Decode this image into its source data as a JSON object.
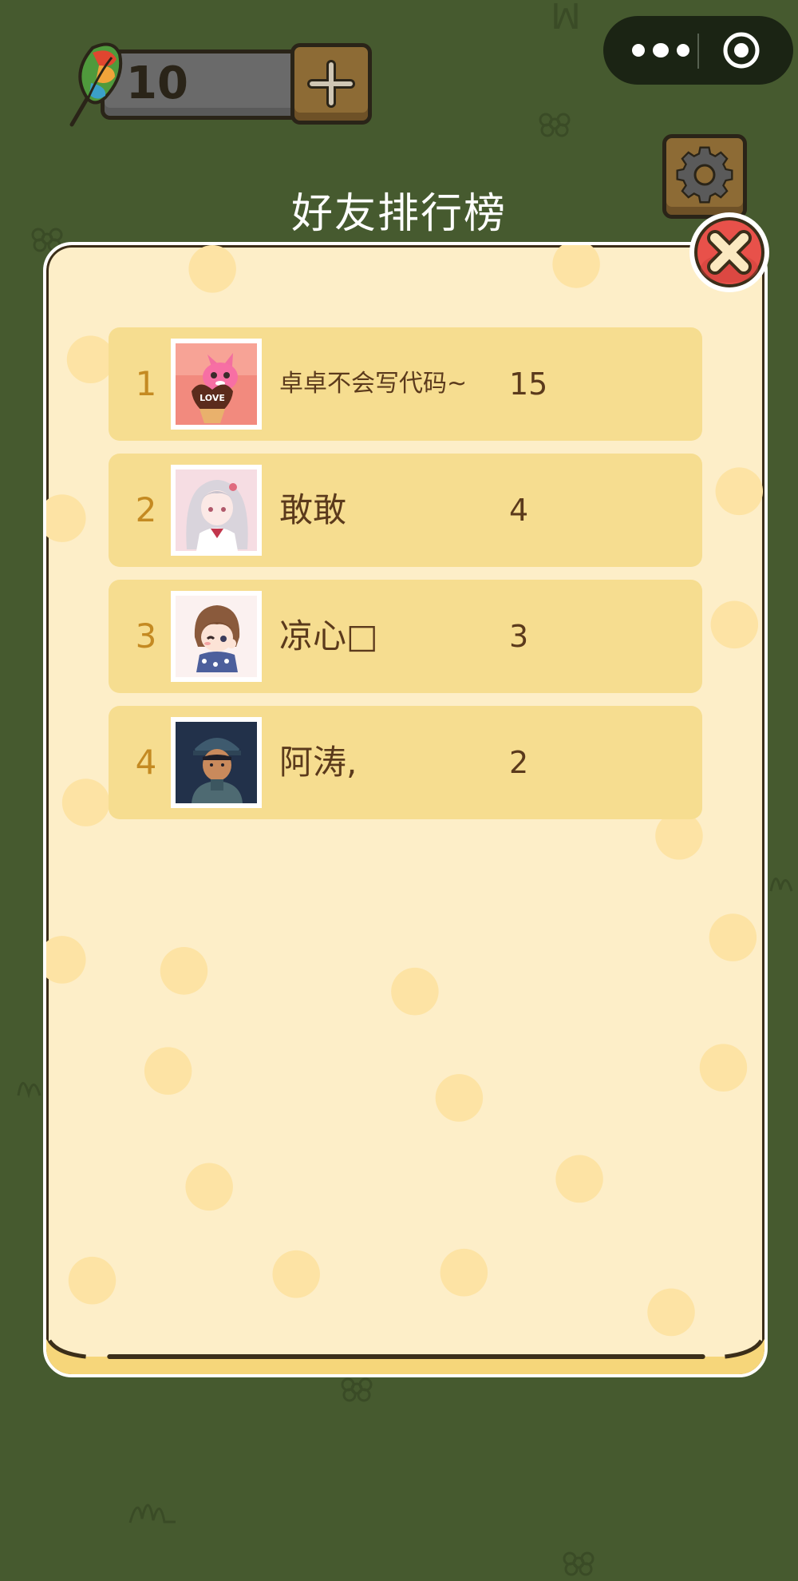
{
  "header": {
    "feather_count": "10",
    "title": "好友排行榜"
  },
  "ranking": [
    {
      "rank": "1",
      "name": "卓卓不会写代码~",
      "score": "15",
      "avatar": "pink-fox-love-avatar"
    },
    {
      "rank": "2",
      "name": "敢敢",
      "score": "4",
      "avatar": "anime-girl-avatar"
    },
    {
      "rank": "3",
      "name": "凉心□",
      "score": "3",
      "avatar": "chibi-girl-avatar"
    },
    {
      "rank": "4",
      "name": "阿涛,",
      "score": "2",
      "avatar": "anime-boy-avatar"
    }
  ],
  "icons": {
    "feather": "feather-icon",
    "add": "plus-icon",
    "menu": "more-dots-icon",
    "exit": "target-circle-icon",
    "settings": "gear-icon",
    "close": "close-icon"
  },
  "colors": {
    "background": "#465a2f",
    "panel": "#fdeec8",
    "row": "#f6dd90",
    "rank_text": "#c48a22",
    "name_text": "#5b3a1c",
    "close_button": "#e8514a",
    "wood_button": "#8d6b35"
  }
}
